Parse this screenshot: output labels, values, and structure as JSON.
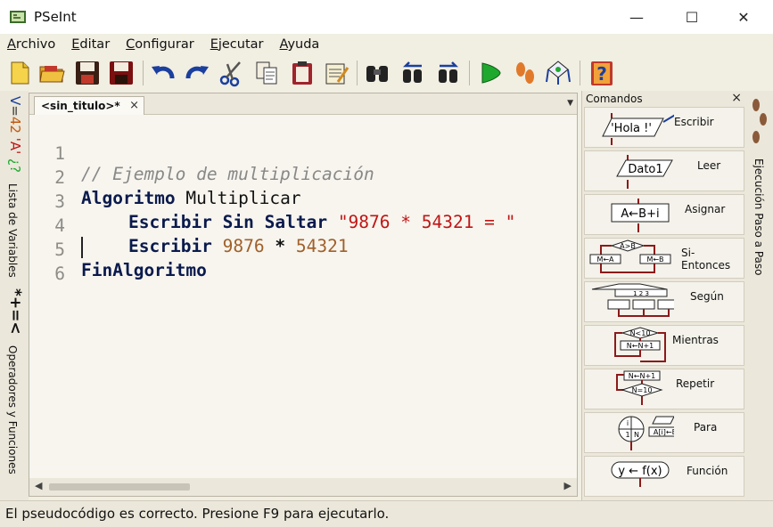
{
  "window": {
    "title": "PSeInt",
    "minimize_label": "—",
    "maximize_label": "☐",
    "close_label": "✕"
  },
  "menubar": {
    "items": [
      {
        "first": "A",
        "rest": "rchivo"
      },
      {
        "first": "E",
        "rest": "ditar"
      },
      {
        "first": "C",
        "rest": "onfigurar"
      },
      {
        "first": "E",
        "rest": "jecutar"
      },
      {
        "first": "A",
        "rest": "yuda"
      }
    ]
  },
  "toolbar": {
    "icons": [
      "new-file-icon",
      "open-folder-icon",
      "save-icon",
      "save-as-icon",
      "undo-icon",
      "redo-icon",
      "cut-icon",
      "copy-icon",
      "paste-icon",
      "edit-icon",
      "find-icon",
      "find-previous-icon",
      "find-next-icon",
      "run-icon",
      "step-by-step-icon",
      "flowchart-icon",
      "help-icon"
    ]
  },
  "left_panel": {
    "variables_label": "Lista de Variables",
    "variables_symbols": "V=42 'A' ¿?",
    "operators_label": "Operadores y Funciones",
    "operators_symbols": "*+=<"
  },
  "editor": {
    "tab_label": "<sin_titulo>*",
    "tab_close": "×",
    "line_numbers": [
      "1",
      "2",
      "3",
      "4",
      "5",
      "6"
    ],
    "lines": {
      "l1_comment": "// Ejemplo de multiplicación",
      "l2_kw": "Algoritmo",
      "l2_name": " Multiplicar",
      "l3_kw": "Escribir Sin Saltar",
      "l3_str": "\"9876 * 54321 = \"",
      "l4_kw": "Escribir",
      "l4_num1": "9876",
      "l4_op": "*",
      "l4_num2": "54321",
      "l5_kw": "FinAlgoritmo"
    }
  },
  "commands": {
    "title": "Comandos",
    "close": "×",
    "items": [
      {
        "label": "Escribir",
        "graphic": "'Hola !'"
      },
      {
        "label": "Leer",
        "graphic": "Dato1"
      },
      {
        "label": "Asignar",
        "graphic": "A←B+i"
      },
      {
        "label": "Si-Entonces",
        "graphic": "A>B"
      },
      {
        "label": "Según",
        "graphic": "1 2 3"
      },
      {
        "label": "Mientras",
        "graphic": "N<10"
      },
      {
        "label": "Repetir",
        "graphic": "N=10"
      },
      {
        "label": "Para",
        "graphic": "i"
      },
      {
        "label": "Función",
        "graphic": "y ← f(x)"
      }
    ]
  },
  "right_panel": {
    "label": "Ejecución Paso a Paso"
  },
  "status": {
    "text": "El pseudocódigo es correcto. Presione F9 para ejecutarlo."
  }
}
